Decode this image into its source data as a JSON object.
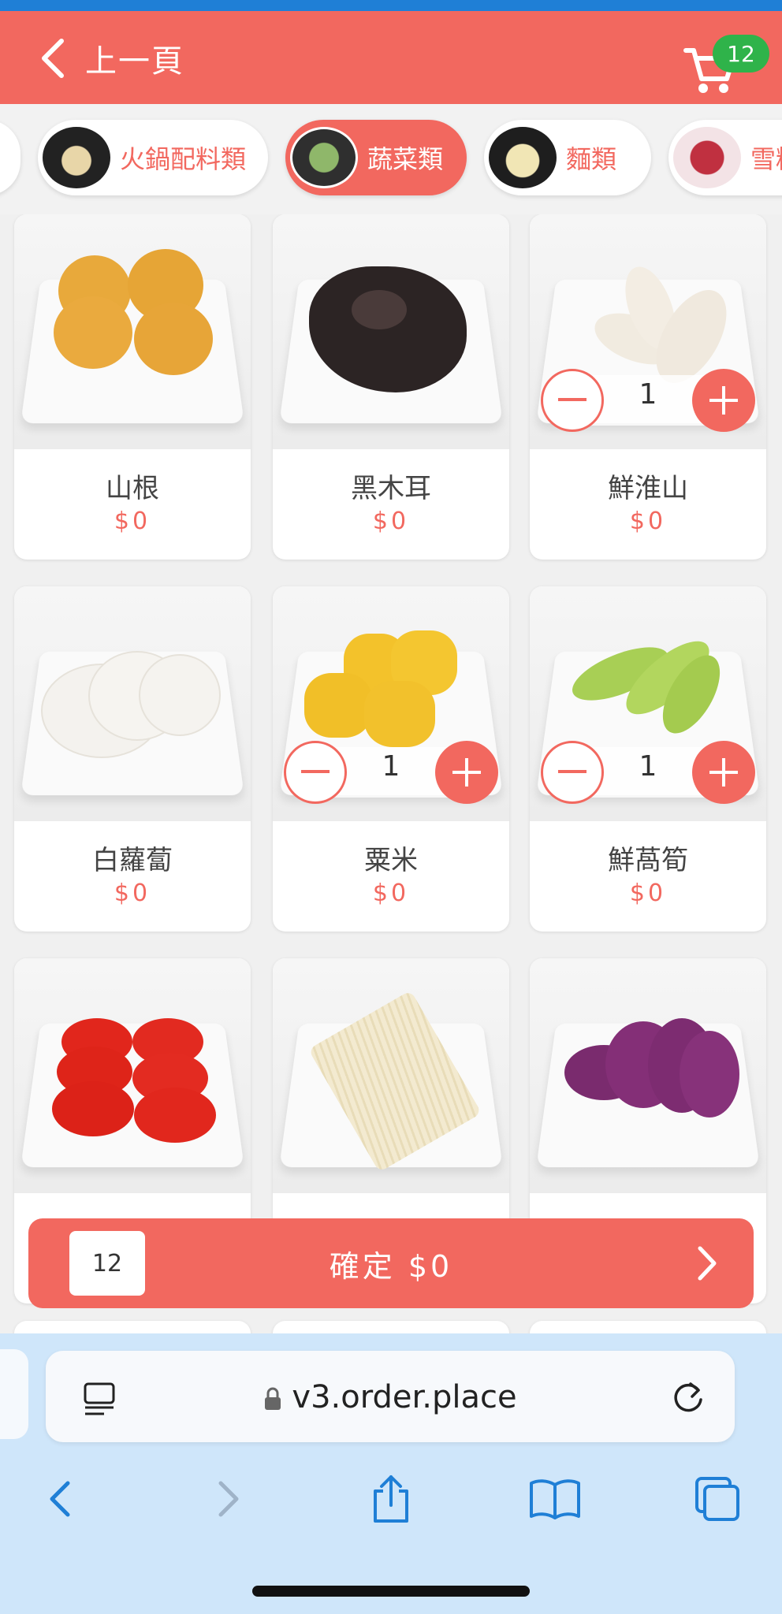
{
  "header": {
    "back_label": "上一頁",
    "cart_count": "12"
  },
  "categories": [
    {
      "label": "",
      "active": false
    },
    {
      "label": "火鍋配料類",
      "active": false
    },
    {
      "label": "蔬菜類",
      "active": true
    },
    {
      "label": "麵類",
      "active": false
    },
    {
      "label": "雪糕",
      "active": false
    }
  ],
  "products": [
    {
      "name": "山根",
      "price": "$0",
      "qty": null
    },
    {
      "name": "黑木耳",
      "price": "$0",
      "qty": null
    },
    {
      "name": "鮮淮山",
      "price": "$0",
      "qty": "1"
    },
    {
      "name": "白蘿蔔",
      "price": "$0",
      "qty": null
    },
    {
      "name": "粟米",
      "price": "$0",
      "qty": "1"
    },
    {
      "name": "鮮萵筍",
      "price": "$0",
      "qty": "1"
    },
    {
      "name": "",
      "price": "",
      "qty": null
    },
    {
      "name": "",
      "price": "",
      "qty": null
    },
    {
      "name": "",
      "price": "",
      "qty": null
    }
  ],
  "confirm": {
    "count": "12",
    "label": "確定 $0"
  },
  "browser": {
    "url": "v3.order.place"
  },
  "colors": {
    "brand": "#f2685f",
    "badge": "#2fb34a",
    "browser_chrome": "#cfe6fa",
    "ios_blue": "#1f7fd6"
  },
  "icons": [
    "chevron-left-icon",
    "cart-icon",
    "minus-icon",
    "plus-icon",
    "chevron-right-icon",
    "reader-icon",
    "lock-icon",
    "reload-icon",
    "back-arrow-icon",
    "forward-arrow-icon",
    "share-icon",
    "bookmarks-icon",
    "tabs-icon"
  ]
}
